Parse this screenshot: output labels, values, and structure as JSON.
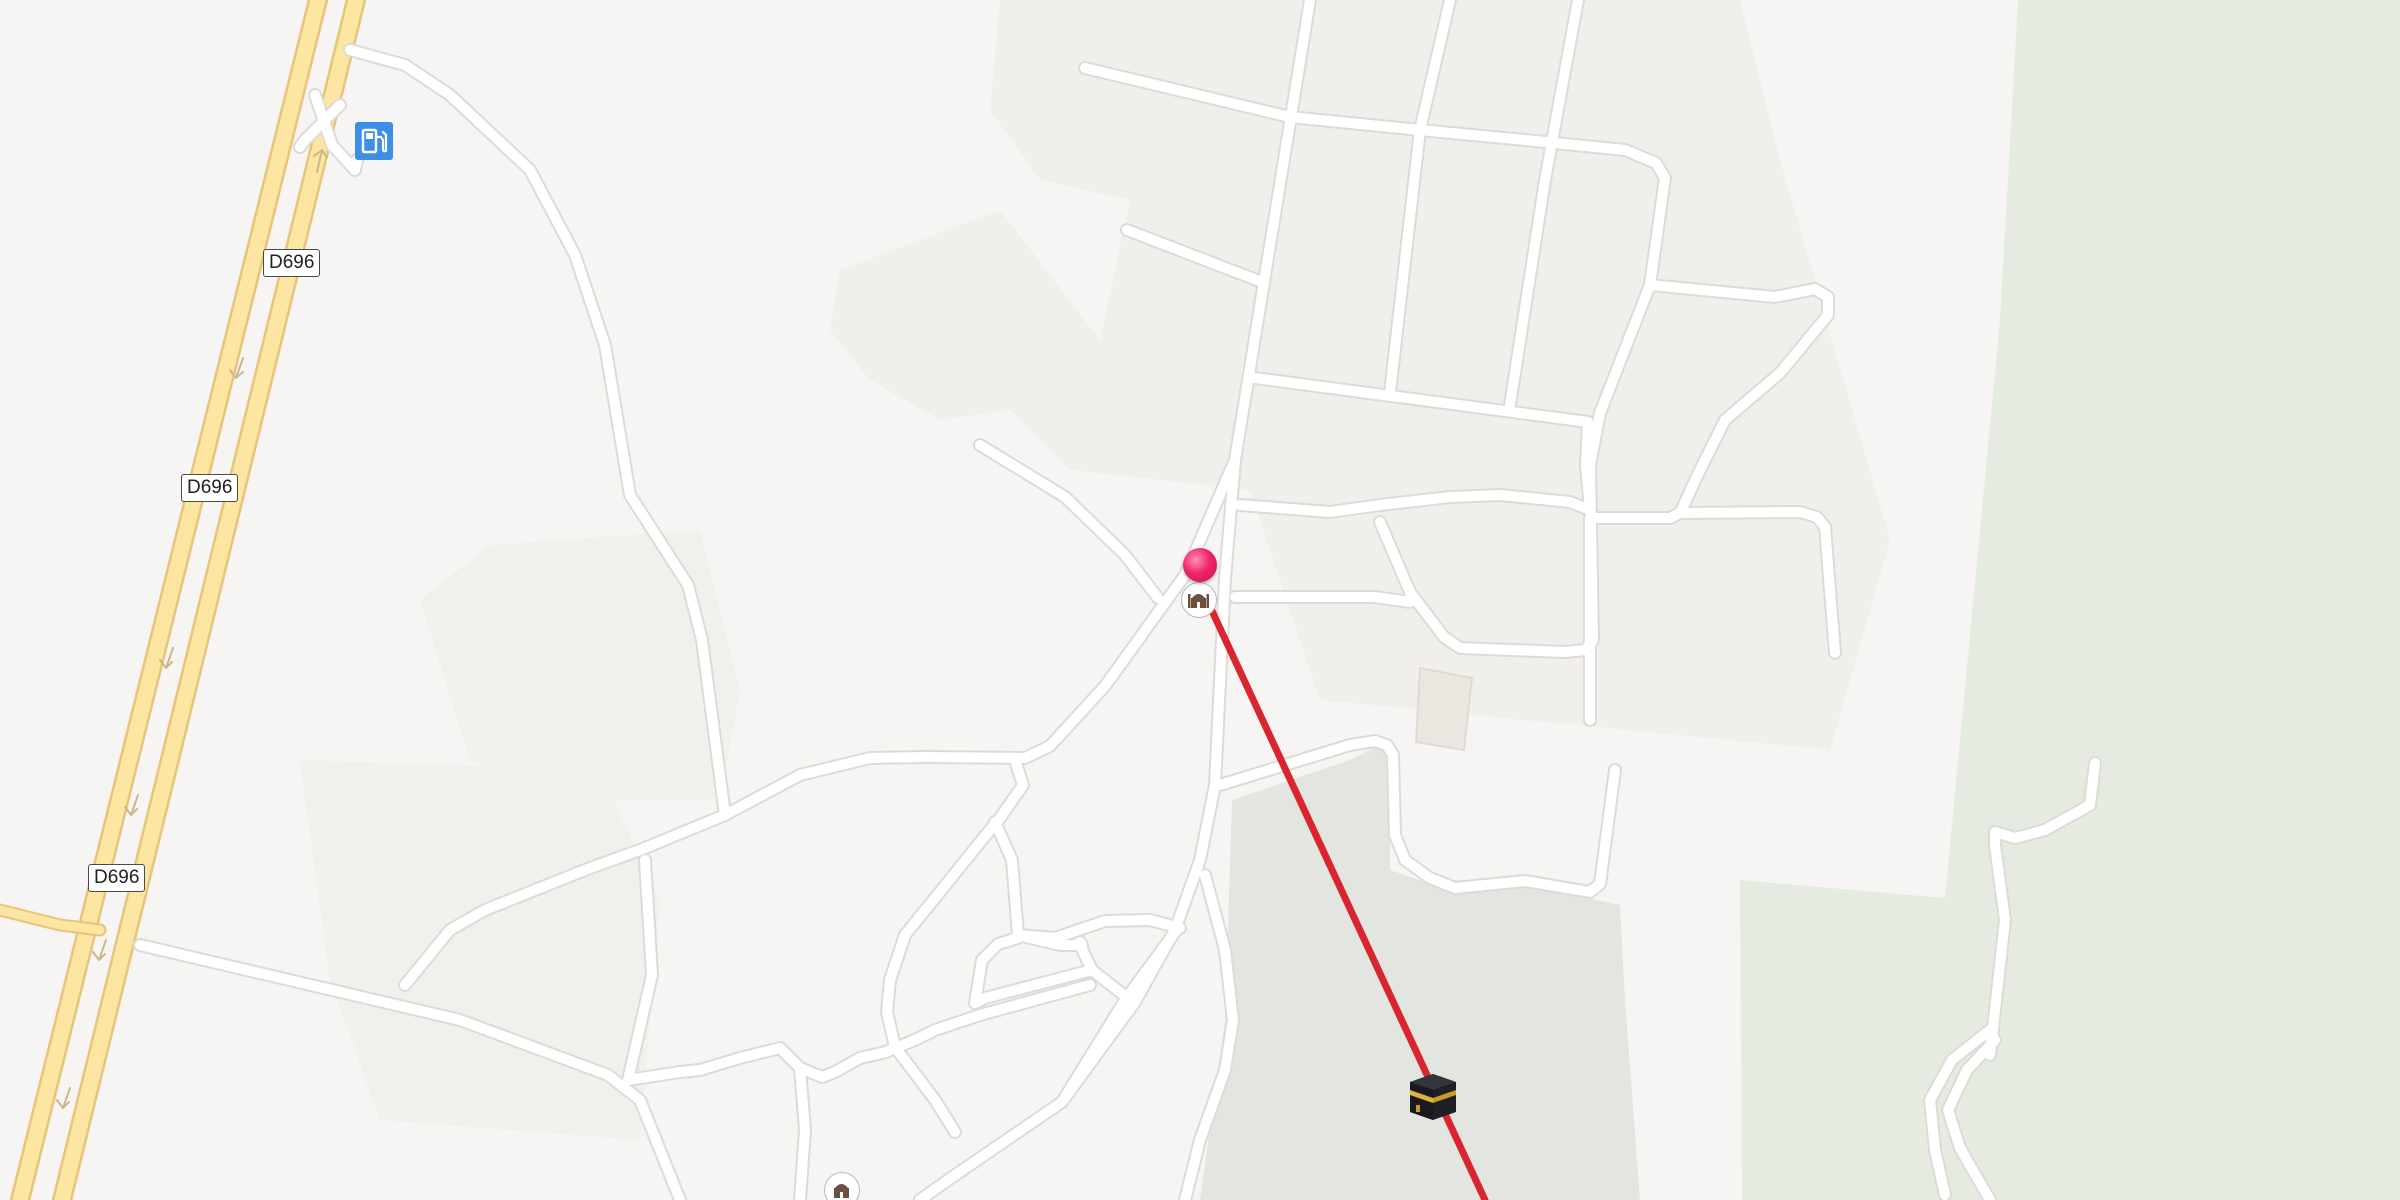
{
  "map": {
    "road_shields": [
      {
        "label": "D696"
      },
      {
        "label": "D696"
      },
      {
        "label": "D696"
      }
    ],
    "icons": {
      "fuel": "fuel-station-icon",
      "pin": "location-pin-icon",
      "mosque": "mosque-icon",
      "kaaba": "kaaba-icon"
    },
    "colors": {
      "background": "#f6f5f3",
      "green_area": "#e3e6e0",
      "highway_fill": "#fde6a2",
      "highway_casing": "#e8c47a",
      "minor_road": "#ffffff",
      "qibla_line": "#d9262e",
      "pin": "#f0246c",
      "fuel": "#3d8fe6"
    }
  }
}
